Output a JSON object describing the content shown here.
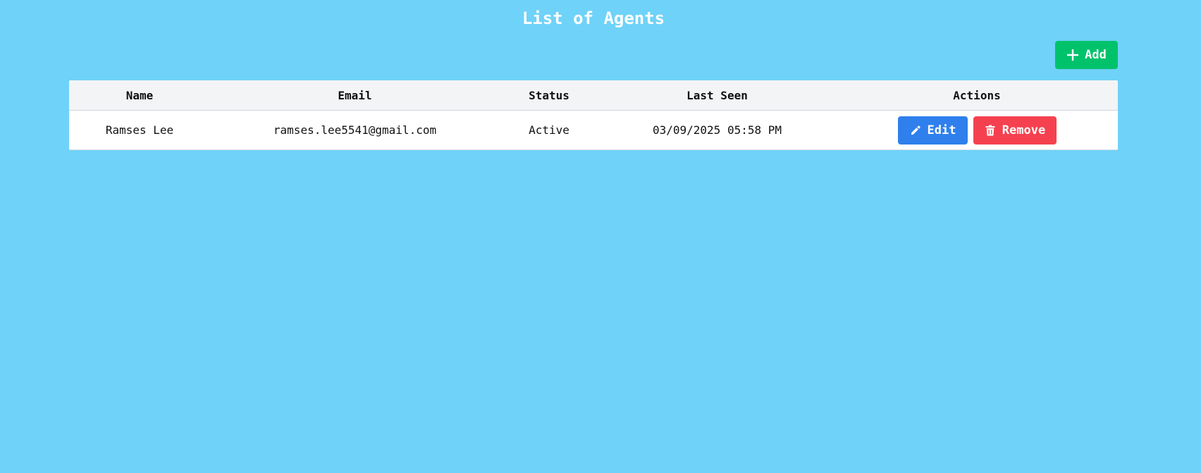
{
  "page": {
    "title": "List of Agents"
  },
  "toolbar": {
    "add_label": "Add",
    "add_icon": "plus-icon",
    "add_color": "#00c26b"
  },
  "table": {
    "columns": [
      "Name",
      "Email",
      "Status",
      "Last Seen",
      "Actions"
    ],
    "rows": [
      {
        "name": "Ramses Lee",
        "email": "ramses.lee5541@gmail.com",
        "status": "Active",
        "last_seen": "03/09/2025 05:58 PM",
        "actions": {
          "edit_label": "Edit",
          "edit_icon": "pencil-icon",
          "edit_color": "#2f80ed",
          "remove_label": "Remove",
          "remove_icon": "trash-icon",
          "remove_color": "#f5414f"
        }
      }
    ]
  },
  "colors": {
    "background": "#6fd2f8",
    "header_background": "#f3f4f6"
  }
}
